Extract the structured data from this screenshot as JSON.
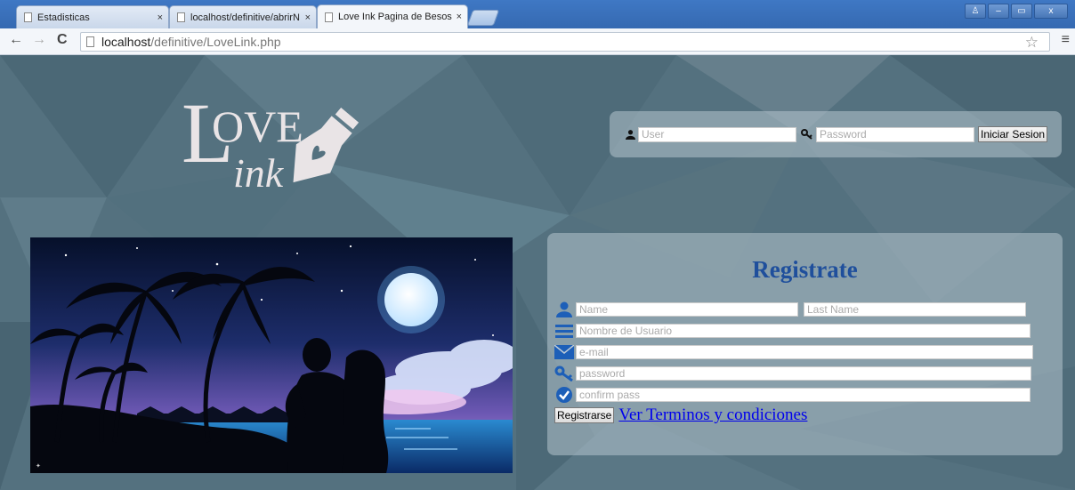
{
  "browser": {
    "tabs": [
      {
        "label": "Estadisticas",
        "close": "×"
      },
      {
        "label": "localhost/definitive/abrirN",
        "close": "×"
      },
      {
        "label": "Love Ink Pagina de Besos",
        "close": "×"
      }
    ],
    "url_host": "localhost",
    "url_path": "/definitive/LoveLink.php",
    "nav": {
      "back": "←",
      "forward": "→",
      "reload": "C"
    },
    "star": "☆",
    "menu": "≡",
    "window_buttons": {
      "user": "♙",
      "minimize": "–",
      "maximize": "▭",
      "close": "x"
    }
  },
  "logo": {
    "line1": "OVE",
    "big_l": "L",
    "line2": "ink"
  },
  "login": {
    "user_placeholder": "User",
    "password_placeholder": "Password",
    "submit_label": "Iniciar Sesion",
    "icons": [
      "user-icon",
      "key-icon"
    ]
  },
  "register": {
    "title": "Registrate",
    "name_placeholder": "Name",
    "last_name_placeholder": "Last Name",
    "username_placeholder": "Nombre de Usuario",
    "email_placeholder": "e-mail",
    "password_placeholder": "password",
    "confirm_placeholder": "confirm pass",
    "submit_label": "Registrarse",
    "terms_link": "Ver Terminos y condiciones",
    "icons": [
      "user-icon",
      "list-icon",
      "envelope-icon",
      "key-icon",
      "check-circle-icon"
    ]
  },
  "colors": {
    "background": "#54717f",
    "title_blue": "#1f4f9c",
    "link_blue": "#0000ee",
    "icon_blue": "#1d5fb8",
    "chrome_blue": "#3f78c4"
  }
}
